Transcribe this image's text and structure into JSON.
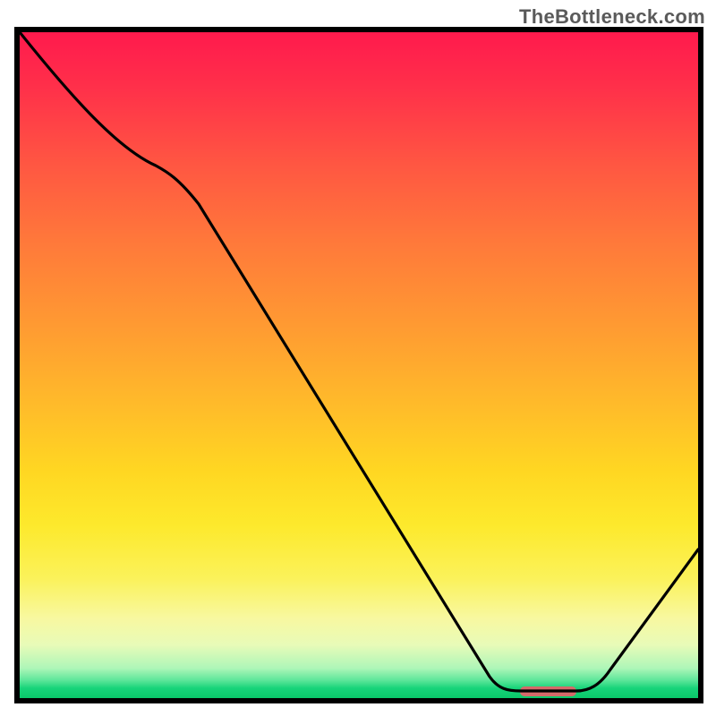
{
  "watermark": "TheBottleneck.com",
  "chart_data": {
    "type": "line",
    "title": "",
    "xlabel": "",
    "ylabel": "",
    "xlim": [
      0,
      100
    ],
    "ylim": [
      0,
      100
    ],
    "series": [
      {
        "name": "bottleneck-curve",
        "x": [
          0,
          20,
          70,
          74,
          82,
          100
        ],
        "y": [
          100,
          80,
          1,
          0.5,
          0.5,
          22
        ]
      }
    ],
    "marker": {
      "name": "optimal-range",
      "x_range": [
        74,
        82
      ],
      "y": 0.6,
      "color": "#d46a6a"
    },
    "gradient_stops": [
      {
        "y": 100,
        "color": "#ff1a4d"
      },
      {
        "y": 56,
        "color": "#ff9a32"
      },
      {
        "y": 26,
        "color": "#fde92c"
      },
      {
        "y": 4,
        "color": "#aef6b8"
      },
      {
        "y": 0,
        "color": "#0ac96a"
      }
    ]
  }
}
